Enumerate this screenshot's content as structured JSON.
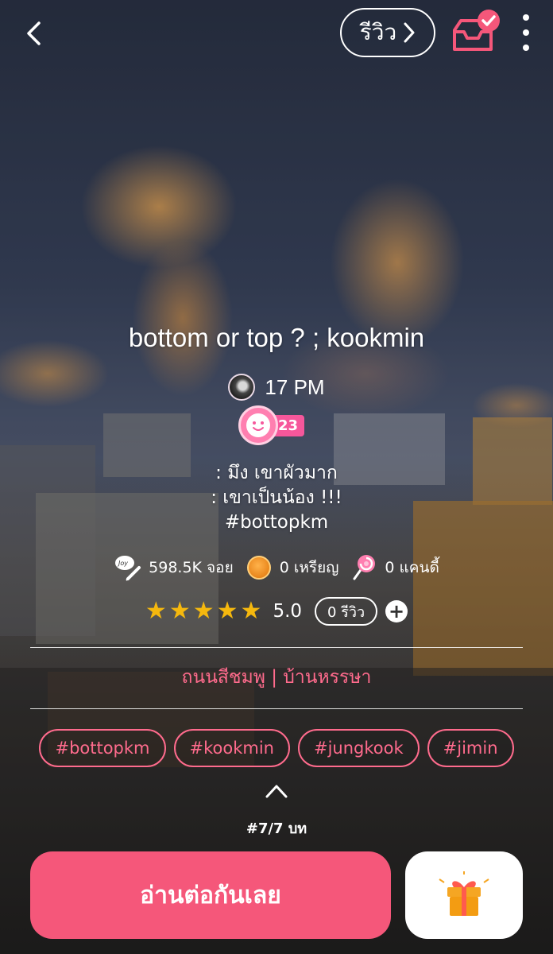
{
  "header": {
    "review_label": "รีวิว",
    "icons": {
      "back": "chevron-left-icon",
      "review_arrow": "chevron-right-icon",
      "shelf": "inbox-check-icon",
      "more": "more-vertical-icon"
    }
  },
  "story": {
    "title": "bottom or top ?  ; kookmin",
    "author": "17 PM",
    "author_level": "23",
    "description": [
      ": มึง เขาผัวมาก",
      ": เขาเป็นน้อง !!!",
      "#bottopkm"
    ],
    "category": "ถนนสีชมพู | บ้านหรรษา",
    "tags": [
      "#bottopkm",
      "#kookmin",
      "#jungkook",
      "#jimin"
    ],
    "chapter_label": "#7/7 บท"
  },
  "stats": {
    "views": "598.5K จอย",
    "coins": "0 เหรียญ",
    "candy": "0 แคนดี้"
  },
  "rating": {
    "stars": 5,
    "value": "5.0",
    "review_count": "0 รีวิว"
  },
  "actions": {
    "read_label": "อ่านต่อกันเลย",
    "add_icon": "+"
  },
  "colors": {
    "accent": "#f5577a",
    "tag": "#ff6b8d",
    "star": "#f5b80e",
    "level": "#f6579b"
  }
}
